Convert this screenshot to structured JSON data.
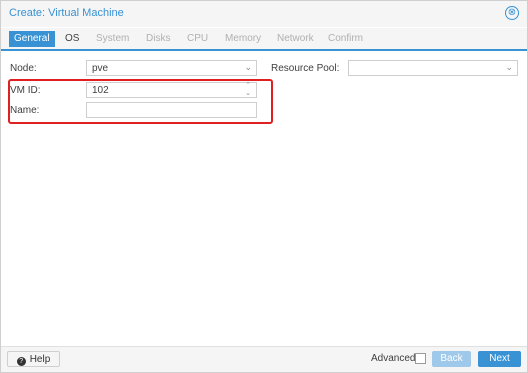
{
  "window": {
    "title": "Create: Virtual Machine",
    "close_glyph": "⊗"
  },
  "tabs": [
    {
      "label": "General",
      "state": "active"
    },
    {
      "label": "OS",
      "state": "enabled"
    },
    {
      "label": "System",
      "state": "disabled"
    },
    {
      "label": "Disks",
      "state": "disabled"
    },
    {
      "label": "CPU",
      "state": "disabled"
    },
    {
      "label": "Memory",
      "state": "disabled"
    },
    {
      "label": "Network",
      "state": "disabled"
    },
    {
      "label": "Confirm",
      "state": "disabled"
    }
  ],
  "form": {
    "node": {
      "label": "Node:",
      "value": "pve"
    },
    "vmid": {
      "label": "VM ID:",
      "value": "102"
    },
    "name": {
      "label": "Name:",
      "value": ""
    },
    "pool": {
      "label": "Resource Pool:",
      "value": ""
    }
  },
  "footer": {
    "help_label": "Help",
    "help_icon_glyph": "?",
    "advanced_label": "Advanced",
    "back_label": "Back",
    "next_label": "Next"
  },
  "colors": {
    "accent": "#3892d4",
    "highlight": "#e02020",
    "back_disabled": "#9fc9ea"
  },
  "icons": {
    "dropdown": "chevron-down-icon",
    "spinner": "spinner-arrows-icon",
    "close": "close-icon",
    "help": "help-icon"
  }
}
